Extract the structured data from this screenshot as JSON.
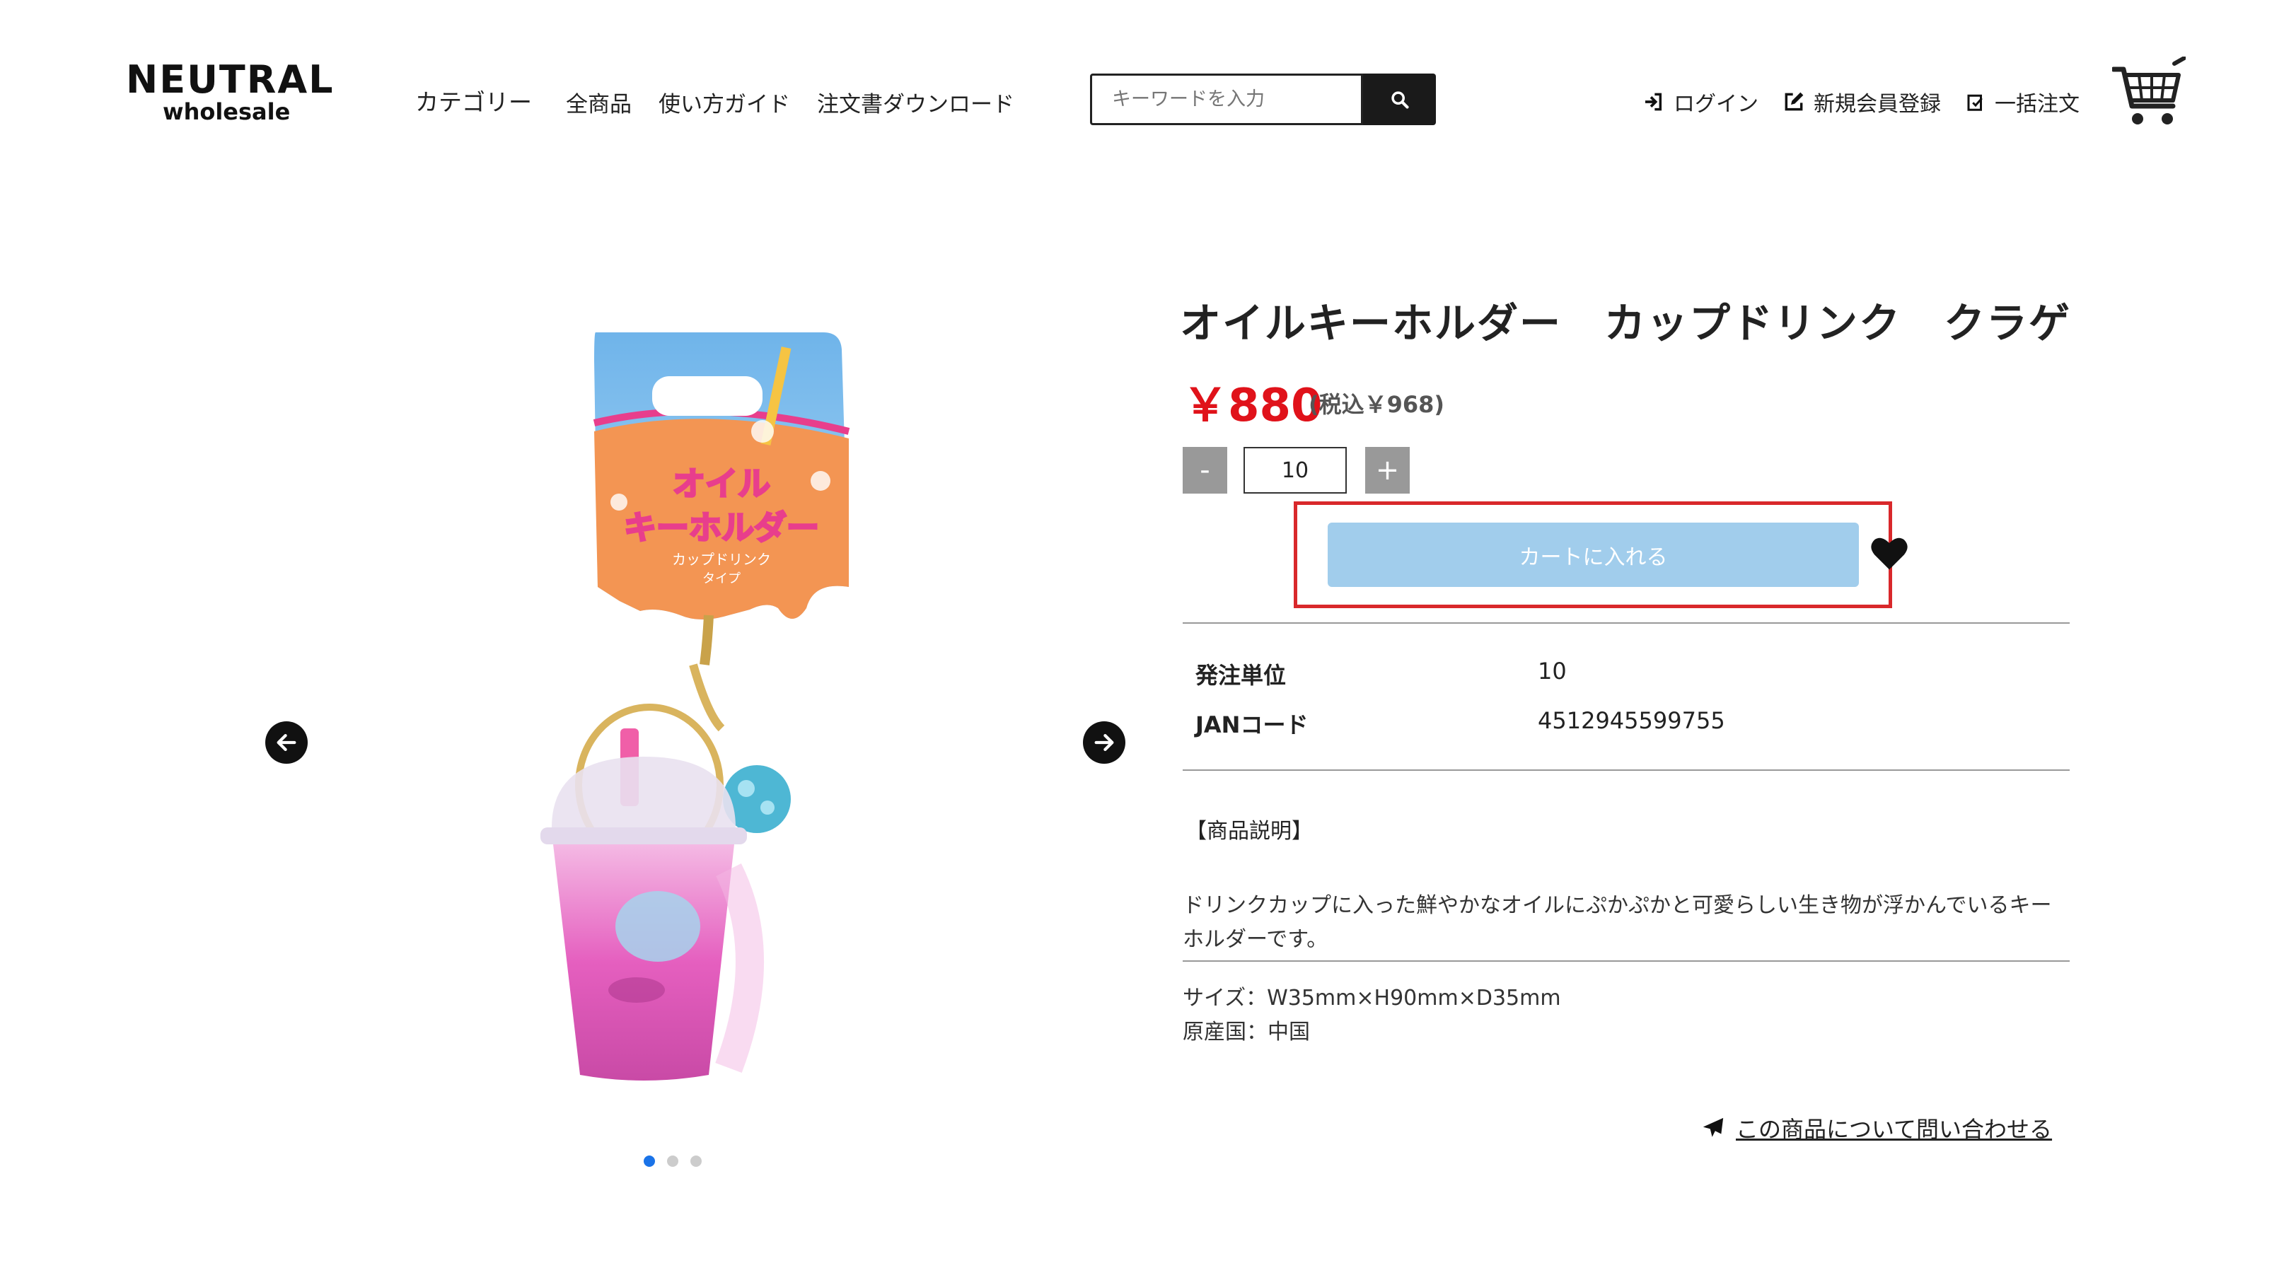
{
  "header": {
    "logo_main": "NEUTRAL",
    "logo_sub": "wholesale",
    "nav": [
      "カテゴリー",
      "全商品",
      "使い方ガイド",
      "注文書ダウンロード"
    ],
    "search_placeholder": "キーワードを入力",
    "links": {
      "login": "ログイン",
      "register": "新規会員登録",
      "bulk_order": "一括注文"
    }
  },
  "gallery": {
    "slide_count": 3,
    "active_slide": 1,
    "package_text": {
      "line1": "オイル",
      "line2": "キーホルダー",
      "line3": "カップドリンク",
      "line4": "タイプ"
    }
  },
  "product": {
    "title": "オイルキーホルダー　カップドリンク　クラゲ",
    "price": "￥880",
    "price_tax": "(税込￥968)",
    "quantity": "10",
    "minus_label": "-",
    "plus_label": "+",
    "add_to_cart": "カートに入れる",
    "specs": [
      {
        "label": "発注単位",
        "value": "10"
      },
      {
        "label": "JANコード",
        "value": "4512945599755"
      }
    ],
    "description_heading": "【商品説明】",
    "description_line1": "ドリンクカップに入った鮮やかなオイルにぷかぷかと可愛らしい生き物が浮かんでいるキー",
    "description_line2": "ホルダーです。",
    "size": "サイズ：W35mm×H90mm×D35mm",
    "origin": "原産国：中国",
    "inquiry": "この商品について問い合わせる"
  },
  "colors": {
    "price": "#e0121a",
    "cart_button": "#a1cdec",
    "highlight": "#d9282b",
    "active_dot": "#1a73e8"
  }
}
